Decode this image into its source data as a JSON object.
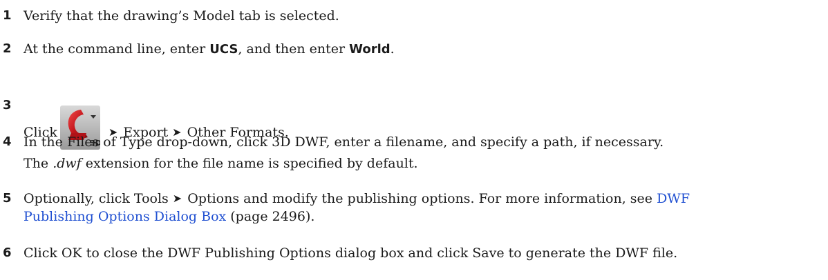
{
  "steps": [
    {
      "number": "1",
      "text": "Verify that the drawing’s Model tab is selected."
    },
    {
      "number": "2",
      "part1": "At the command line, enter ",
      "bold1": "UCS",
      "part2": ", and then enter ",
      "bold2": "World",
      "part3": "."
    },
    {
      "number": "3",
      "click": "Click",
      "icon_label": "3D",
      "icon": "application-menu-3d-icon",
      "arrow": "➤",
      "item1": "Export",
      "item2": "Other Formats."
    },
    {
      "number": "4",
      "text": "In the Files of Type drop-down, click 3D DWF, enter a filename, and specify a path, if necessary.",
      "sub_pre": "The ",
      "sub_ext": ".dwf",
      "sub_post": " extension for the file name is specified by default."
    },
    {
      "number": "5",
      "part1": "Optionally, click Tools",
      "arrow": "➤",
      "part2": "Options and modify the publishing options. For more information, see ",
      "link_line1": "DWF",
      "link_line2": "Publishing Options Dialog Box",
      "page_ref": " (page 2496)."
    },
    {
      "number": "6",
      "text": "Click OK to close the DWF Publishing Options dialog box and click Save to generate the DWF file."
    }
  ],
  "colors": {
    "text": "#1a1a1a",
    "link": "#1f4fd1",
    "icon_red": "#c4161c"
  }
}
